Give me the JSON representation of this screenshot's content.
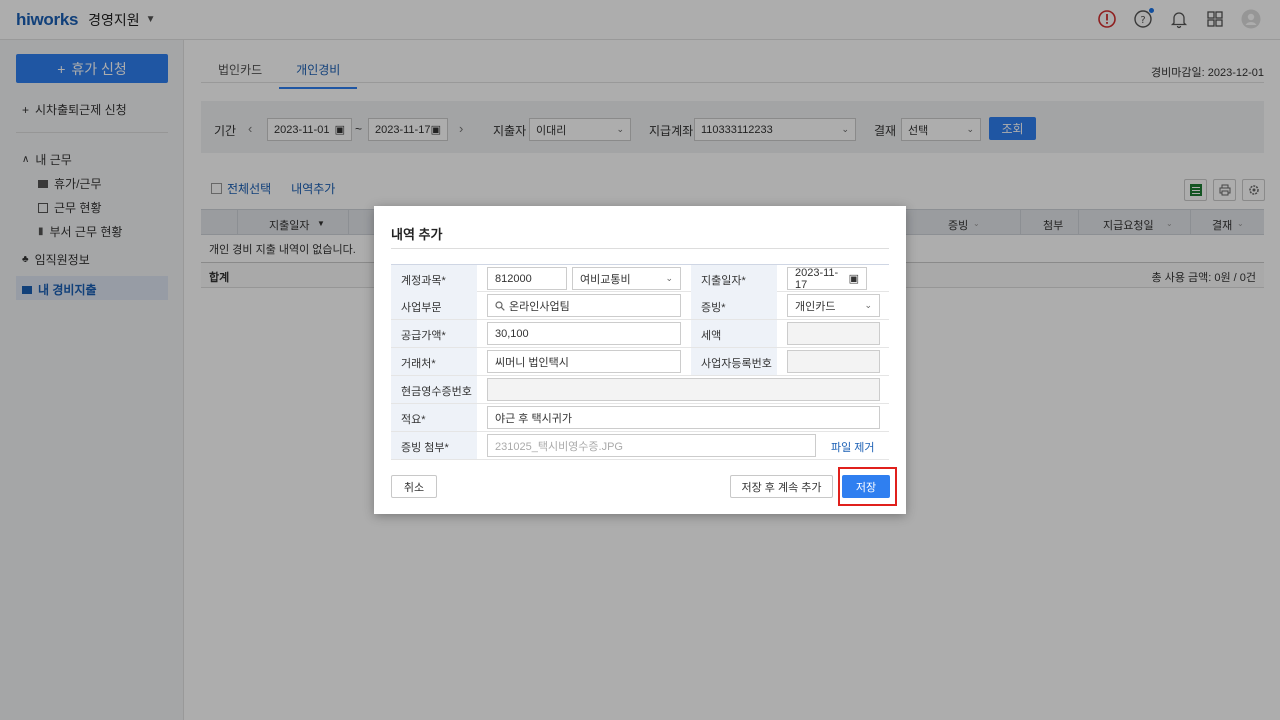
{
  "header": {
    "logo": "hiworks",
    "app_name": "경영지원",
    "icons": [
      "alert-icon",
      "help-icon",
      "bell-icon",
      "apps-grid-icon",
      "user-avatar-icon"
    ]
  },
  "sidebar": {
    "apply_button": "휴가 신청",
    "items": [
      {
        "label": "시차출퇴근제 신청"
      },
      {
        "label": "내 근무"
      },
      {
        "label": "휴가/근무"
      },
      {
        "label": "근무 현황"
      },
      {
        "label": "부서 근무 현황"
      },
      {
        "label": "임직원정보"
      },
      {
        "label": "내 경비지출"
      }
    ]
  },
  "tabs": [
    {
      "label": "법인카드"
    },
    {
      "label": "개인경비"
    }
  ],
  "deadline": "경비마감일: 2023-12-01",
  "filter": {
    "period_label": "기간",
    "date_from": "2023-11-01",
    "date_sep": "~",
    "date_to": "2023-11-17",
    "spender_label": "지출자",
    "spender_value": "이대리",
    "account_label": "지급계좌",
    "account_value": "110333112233",
    "approval_label": "결재",
    "approval_value": "선택",
    "search_button": "조회"
  },
  "list_actions": {
    "select_all": "전체선택",
    "add_item": "내역추가"
  },
  "table": {
    "columns": [
      "지출일자",
      "증빙",
      "첨부",
      "지급요청일",
      "결재"
    ],
    "empty_message": "개인 경비 지출 내역이 없습니다.",
    "sum_label": "합계",
    "sum_total": "총 사용 금액: 0원 / 0건"
  },
  "modal": {
    "title": "내역 추가",
    "fields": {
      "account_label": "계정과목*",
      "account_code": "812000",
      "account_name": "여비교통비",
      "date_label": "지출일자*",
      "date_value": "2023-11-17",
      "dept_label": "사업부문",
      "dept_value": "온라인사업팀",
      "evidence_label": "증빙*",
      "evidence_value": "개인카드",
      "supply_label": "공급가액*",
      "supply_value": "30,100",
      "tax_label": "세액",
      "tax_value": "",
      "vendor_label": "거래처*",
      "vendor_value": "씨머니 법인택시",
      "biznum_label": "사업자등록번호",
      "biznum_value": "",
      "cash_receipt_label": "현금영수증번호",
      "cash_receipt_value": "",
      "summary_label": "적요*",
      "summary_value": "야근 후 택시귀가",
      "attach_label": "증빙 첨부*",
      "attach_value": "231025_택시비영수증.JPG",
      "attach_remove": "파일 제거"
    },
    "buttons": {
      "cancel": "취소",
      "save_continue": "저장 후 계속 추가",
      "save": "저장"
    }
  }
}
